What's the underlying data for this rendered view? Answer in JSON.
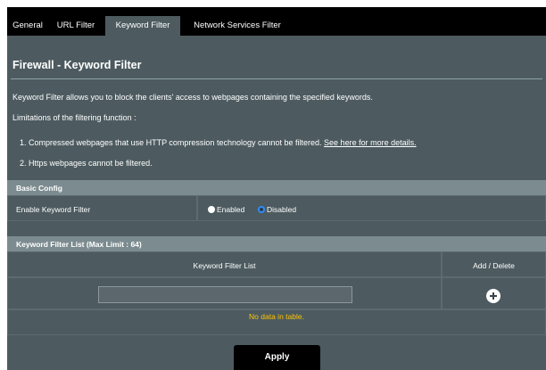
{
  "tabs": [
    "General",
    "URL Filter",
    "Keyword Filter",
    "Network Services Filter"
  ],
  "page_title": "Firewall - Keyword Filter",
  "description": "Keyword Filter allows you to block the clients' access to webpages containing the specified keywords.",
  "limitations_heading": "Limitations of the filtering function :",
  "limitation_1": "1. Compressed webpages that use HTTP compression technology cannot be filtered.",
  "limitation_1_link": "See here for more details.",
  "limitation_2": "2. Https webpages cannot be filtered.",
  "basic_config": {
    "header": "Basic Config",
    "enable_label": "Enable Keyword Filter",
    "enabled_option": "Enabled",
    "disabled_option": "Disabled",
    "selected": "Disabled"
  },
  "keyword_list": {
    "header": "Keyword Filter List (Max Limit : 64)",
    "col_keyword": "Keyword Filter List",
    "col_add_delete": "Add / Delete",
    "input_value": "",
    "no_data": "No data in table."
  },
  "apply_label": "Apply",
  "colors": {
    "accent_radio": "#2e8cff",
    "no_data_text": "#ffc400",
    "background": "#4d5b60"
  }
}
